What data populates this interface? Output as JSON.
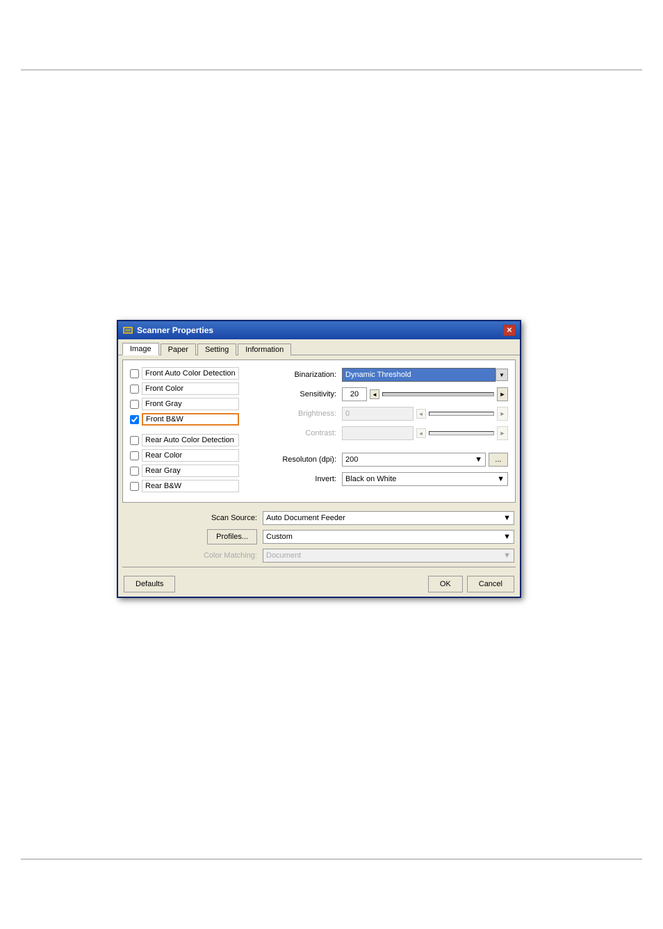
{
  "page": {
    "background": "#ffffff"
  },
  "dialog": {
    "title": "Scanner Properties",
    "close_btn": "✕",
    "tabs": [
      {
        "label": "Image",
        "active": true
      },
      {
        "label": "Paper",
        "active": false
      },
      {
        "label": "Setting",
        "active": false
      },
      {
        "label": "Information",
        "active": false
      }
    ],
    "left_panel": {
      "front_items": [
        {
          "label": "Front Auto Color Detection",
          "checked": false,
          "highlighted": false
        },
        {
          "label": "Front Color",
          "checked": false,
          "highlighted": false
        },
        {
          "label": "Front Gray",
          "checked": false,
          "highlighted": false
        },
        {
          "label": "Front B&W",
          "checked": true,
          "highlighted": true
        }
      ],
      "rear_items": [
        {
          "label": "Rear Auto Color Detection",
          "checked": false,
          "highlighted": false
        },
        {
          "label": "Rear Color",
          "checked": false,
          "highlighted": false
        },
        {
          "label": "Rear Gray",
          "checked": false,
          "highlighted": false
        },
        {
          "label": "Rear B&W",
          "checked": false,
          "highlighted": false
        }
      ]
    },
    "right_panel": {
      "binarization_label": "Binarization:",
      "binarization_value": "Dynamic Threshold",
      "sensitivity_label": "Sensitivity:",
      "sensitivity_value": "20",
      "brightness_label": "Brightness:",
      "brightness_value": "0",
      "contrast_label": "Contrast:",
      "resolution_label": "Resoluton (dpi):",
      "resolution_value": "200",
      "resolution_dots": "...",
      "invert_label": "Invert:",
      "invert_value": "Black on White"
    },
    "bottom": {
      "scan_source_label": "Scan Source:",
      "scan_source_value": "Auto Document Feeder",
      "profiles_label": "Profiles...",
      "profiles_value": "Custom",
      "color_matching_label": "Color Matching:",
      "color_matching_value": "Document"
    },
    "footer": {
      "defaults_label": "Defaults",
      "ok_label": "OK",
      "cancel_label": "Cancel"
    }
  }
}
